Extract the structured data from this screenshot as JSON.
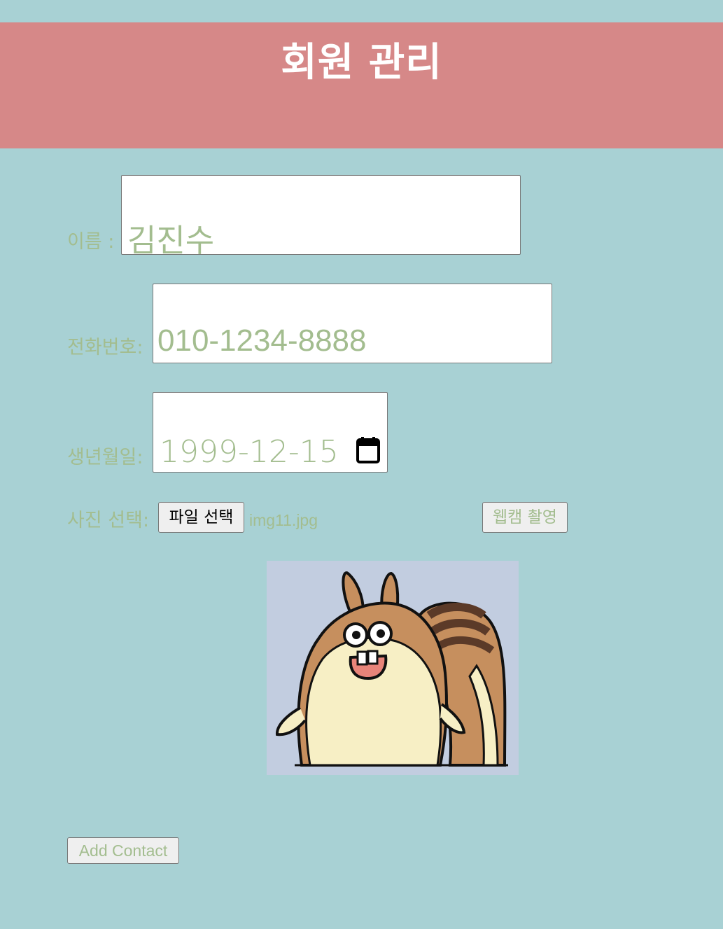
{
  "header": {
    "title": "회원 관리"
  },
  "form": {
    "name": {
      "label": "이름 :",
      "value": "김진수"
    },
    "phone": {
      "label": "전화번호:",
      "value": "010-1234-8888"
    },
    "birth": {
      "label": "생년월일:",
      "value": "1999-12-15",
      "icon": "calendar-icon"
    },
    "photo": {
      "label": "사진 선택:",
      "file_button_label": "파일 선택",
      "file_name": "img11.jpg",
      "webcam_button_label": "웹캠 촬영",
      "preview_description": "cartoon squirrel"
    },
    "submit_label": "Add Contact"
  },
  "colors": {
    "background": "#a8d1d4",
    "header": "#d68888",
    "text_accent": "#a3bd8f"
  }
}
